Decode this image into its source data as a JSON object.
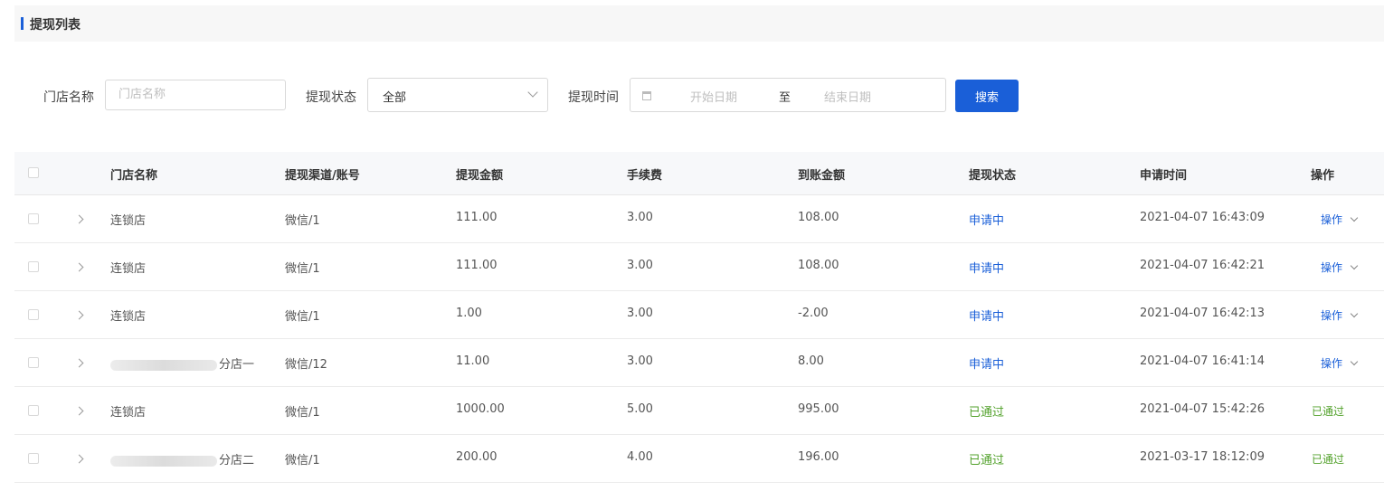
{
  "panel": {
    "title": "提现列表"
  },
  "filters": {
    "store_label": "门店名称",
    "store_placeholder": "门店名称",
    "status_label": "提现状态",
    "status_value": "全部",
    "time_label": "提现时间",
    "start_placeholder": "开始日期",
    "range_separator": "至",
    "end_placeholder": "结束日期",
    "search_label": "搜索"
  },
  "table": {
    "columns": [
      "门店名称",
      "提现渠道/账号",
      "提现金额",
      "手续费",
      "到账金额",
      "提现状态",
      "申请时间",
      "操作"
    ],
    "rows": [
      {
        "store": "连锁店",
        "channel": "微信/1",
        "amount": "111.00",
        "fee": "3.00",
        "received": "108.00",
        "status": "申请中",
        "status_type": "pending",
        "time": "2021-04-07 16:43:09",
        "op": "操作"
      },
      {
        "store": "连锁店",
        "channel": "微信/1",
        "amount": "111.00",
        "fee": "3.00",
        "received": "108.00",
        "status": "申请中",
        "status_type": "pending",
        "time": "2021-04-07 16:42:21",
        "op": "操作"
      },
      {
        "store": "连锁店",
        "channel": "微信/1",
        "amount": "1.00",
        "fee": "3.00",
        "received": "-2.00",
        "status": "申请中",
        "status_type": "pending",
        "time": "2021-04-07 16:42:13",
        "op": "操作"
      },
      {
        "store": "分店一",
        "store_blurred": true,
        "channel": "微信/12",
        "amount": "11.00",
        "fee": "3.00",
        "received": "8.00",
        "status": "申请中",
        "status_type": "pending",
        "time": "2021-04-07 16:41:14",
        "op": "操作"
      },
      {
        "store": "连锁店",
        "channel": "微信/1",
        "amount": "1000.00",
        "fee": "5.00",
        "received": "995.00",
        "status": "已通过",
        "status_type": "passed",
        "time": "2021-04-07 15:42:26",
        "op": "已通过"
      },
      {
        "store": "分店二",
        "store_blurred": true,
        "channel": "微信/1",
        "amount": "200.00",
        "fee": "4.00",
        "received": "196.00",
        "status": "已通过",
        "status_type": "passed",
        "time": "2021-03-17 18:12:09",
        "op": "已通过"
      }
    ]
  },
  "colors": {
    "accent": "#1a5fd8",
    "passed": "#52a12b"
  }
}
